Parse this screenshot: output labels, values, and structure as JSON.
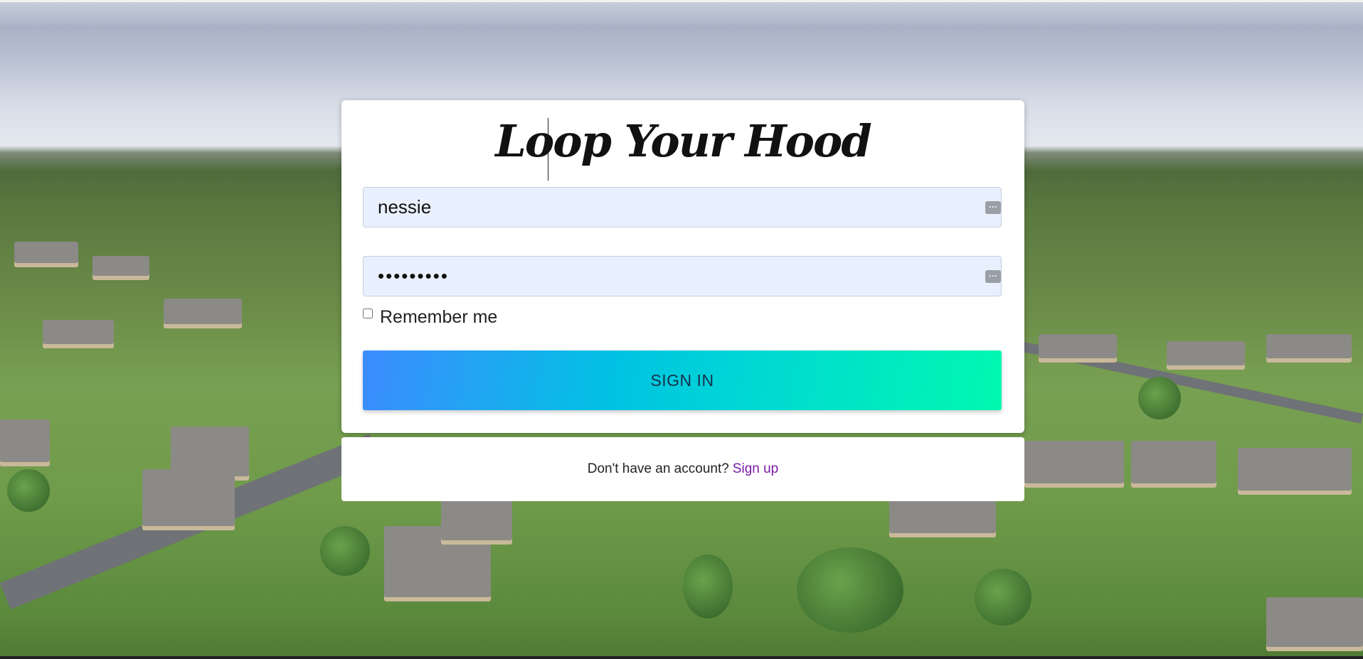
{
  "app": {
    "brand_title": "Loop Your Hood"
  },
  "login": {
    "username_value": "nessie",
    "password_value": "•••••••••",
    "remember_label": "Remember me",
    "signin_label": "SIGN IN"
  },
  "footer": {
    "prompt_text": "Don't have an account?",
    "signup_link": "Sign up"
  },
  "colors": {
    "button_gradient_start": "#3d8bff",
    "button_gradient_end": "#00f9b0",
    "link": "#7a1aa6",
    "input_bg": "#e8f0fe"
  },
  "icons": {
    "field_autofill": "more-dots-icon"
  }
}
